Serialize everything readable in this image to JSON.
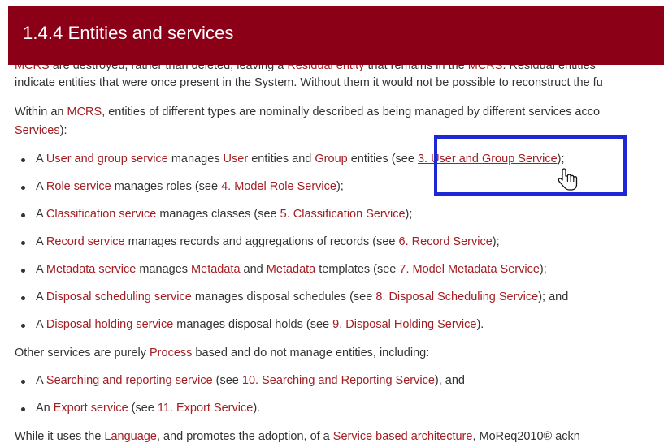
{
  "header": {
    "title": "1.4.4 Entities and services"
  },
  "cut_line_1": [
    {
      "t": "MCRS",
      "link": true
    },
    {
      "t": " are destroyed, rather than deleted, leaving a ",
      "link": false
    },
    {
      "t": "Residual entity",
      "link": true
    },
    {
      "t": " that remains in the ",
      "link": false
    },
    {
      "t": "MCRS",
      "link": true
    },
    {
      "t": ". Residual entities",
      "link": false
    }
  ],
  "para1_line2": "indicate entities that were once present in the System. Without them it would not be possible to reconstruct the fu",
  "para2_line1": [
    {
      "t": "Within an ",
      "link": false
    },
    {
      "t": "MCRS",
      "link": true
    },
    {
      "t": ", entities of different types are nominally described as being managed by different services acco",
      "link": false
    }
  ],
  "para2_line2": [
    {
      "t": "Services",
      "link": true
    },
    {
      "t": "):",
      "link": false
    }
  ],
  "bullets1": [
    [
      {
        "t": "A ",
        "link": false
      },
      {
        "t": "User and group service",
        "link": true
      },
      {
        "t": " manages ",
        "link": false
      },
      {
        "t": "User",
        "link": true
      },
      {
        "t": " entities and ",
        "link": false
      },
      {
        "t": "Group",
        "link": true
      },
      {
        "t": " entities (see ",
        "link": false
      },
      {
        "t": "3. User and Group Service",
        "link": true,
        "under": true
      },
      {
        "t": ");",
        "link": false
      }
    ],
    [
      {
        "t": "A ",
        "link": false
      },
      {
        "t": "Role service",
        "link": true
      },
      {
        "t": " manages roles (see ",
        "link": false
      },
      {
        "t": "4. Model Role Service",
        "link": true
      },
      {
        "t": ");",
        "link": false
      }
    ],
    [
      {
        "t": "A ",
        "link": false
      },
      {
        "t": "Classification service",
        "link": true
      },
      {
        "t": " manages classes (see ",
        "link": false
      },
      {
        "t": "5. Classification Service",
        "link": true
      },
      {
        "t": ");",
        "link": false
      }
    ],
    [
      {
        "t": "A ",
        "link": false
      },
      {
        "t": "Record service",
        "link": true
      },
      {
        "t": " manages records and aggregations of records (see ",
        "link": false
      },
      {
        "t": "6. Record Service",
        "link": true
      },
      {
        "t": ");",
        "link": false
      }
    ],
    [
      {
        "t": "A ",
        "link": false
      },
      {
        "t": "Metadata service",
        "link": true
      },
      {
        "t": " manages ",
        "link": false
      },
      {
        "t": "Metadata",
        "link": true
      },
      {
        "t": " and ",
        "link": false
      },
      {
        "t": "Metadata",
        "link": true
      },
      {
        "t": " templates (see ",
        "link": false
      },
      {
        "t": "7. Model Metadata Service",
        "link": true
      },
      {
        "t": ");",
        "link": false
      }
    ],
    [
      {
        "t": "A ",
        "link": false
      },
      {
        "t": "Disposal scheduling service",
        "link": true
      },
      {
        "t": " manages disposal schedules (see ",
        "link": false
      },
      {
        "t": "8. Disposal Scheduling Service",
        "link": true
      },
      {
        "t": "); and",
        "link": false
      }
    ],
    [
      {
        "t": "A ",
        "link": false
      },
      {
        "t": "Disposal holding service",
        "link": true
      },
      {
        "t": " manages disposal holds (see ",
        "link": false
      },
      {
        "t": "9. Disposal Holding Service",
        "link": true
      },
      {
        "t": ").",
        "link": false
      }
    ]
  ],
  "para3": [
    {
      "t": "Other services are purely ",
      "link": false
    },
    {
      "t": "Process",
      "link": true
    },
    {
      "t": " based and do not manage entities, including:",
      "link": false
    }
  ],
  "bullets2": [
    [
      {
        "t": "A ",
        "link": false
      },
      {
        "t": "Searching and reporting service",
        "link": true
      },
      {
        "t": " (see ",
        "link": false
      },
      {
        "t": "10. Searching and Reporting Service",
        "link": true
      },
      {
        "t": "), and",
        "link": false
      }
    ],
    [
      {
        "t": "An ",
        "link": false
      },
      {
        "t": "Export service",
        "link": true
      },
      {
        "t": " (see ",
        "link": false
      },
      {
        "t": "11. Export Service",
        "link": true
      },
      {
        "t": ").",
        "link": false
      }
    ]
  ],
  "para4": [
    {
      "t": "While it uses the ",
      "link": false
    },
    {
      "t": "Language",
      "link": true
    },
    {
      "t": ", and promotes the adoption, of a ",
      "link": false
    },
    {
      "t": "Service based architecture",
      "link": true
    },
    {
      "t": ", MoReq2010® ackn",
      "link": false
    }
  ],
  "colors": {
    "header_bg": "#8b0017",
    "link": "#a31d22",
    "highlight": "#1e27d6",
    "text": "#333333"
  },
  "icons": {
    "cursor": "hand-pointer-icon"
  }
}
